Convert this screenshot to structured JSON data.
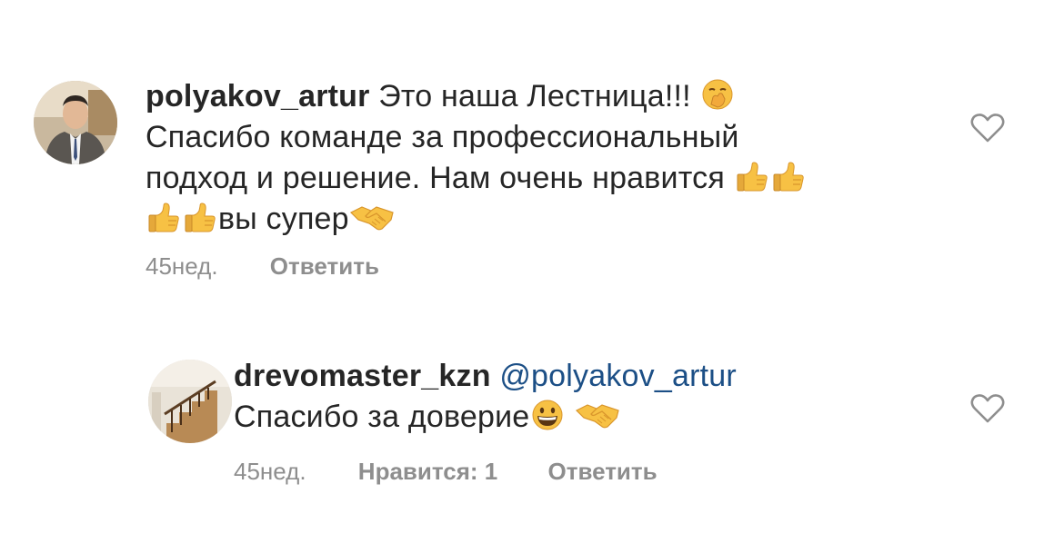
{
  "comments": [
    {
      "username": "polyakov_artur",
      "text_line1": "Это наша Лестница!!!",
      "text_line2": "Спасибо команде  за профессиональный",
      "text_line3": "подход и решение. Нам очень нравится",
      "text_line4": "вы супер",
      "time": "45нед.",
      "reply_label": "Ответить",
      "avatar_icon": "man-in-suit-avatar",
      "emojis": [
        "face-with-hand-over-mouth",
        "thumbs-up",
        "thumbs-up",
        "thumbs-up",
        "thumbs-up",
        "handshake"
      ]
    },
    {
      "username": "drevomaster_kzn",
      "mention": "@polyakov_artur",
      "text_line2": "Спасибо за доверие",
      "time": "45нед.",
      "likes_label": "Нравится: 1",
      "reply_label": "Ответить",
      "avatar_icon": "wooden-staircase-avatar",
      "emojis": [
        "grinning-face",
        "handshake"
      ]
    }
  ],
  "colors": {
    "text": "#262626",
    "meta": "#8e8e8e",
    "mention": "#1c4f86",
    "emoji_yellow": "#f7c144"
  }
}
